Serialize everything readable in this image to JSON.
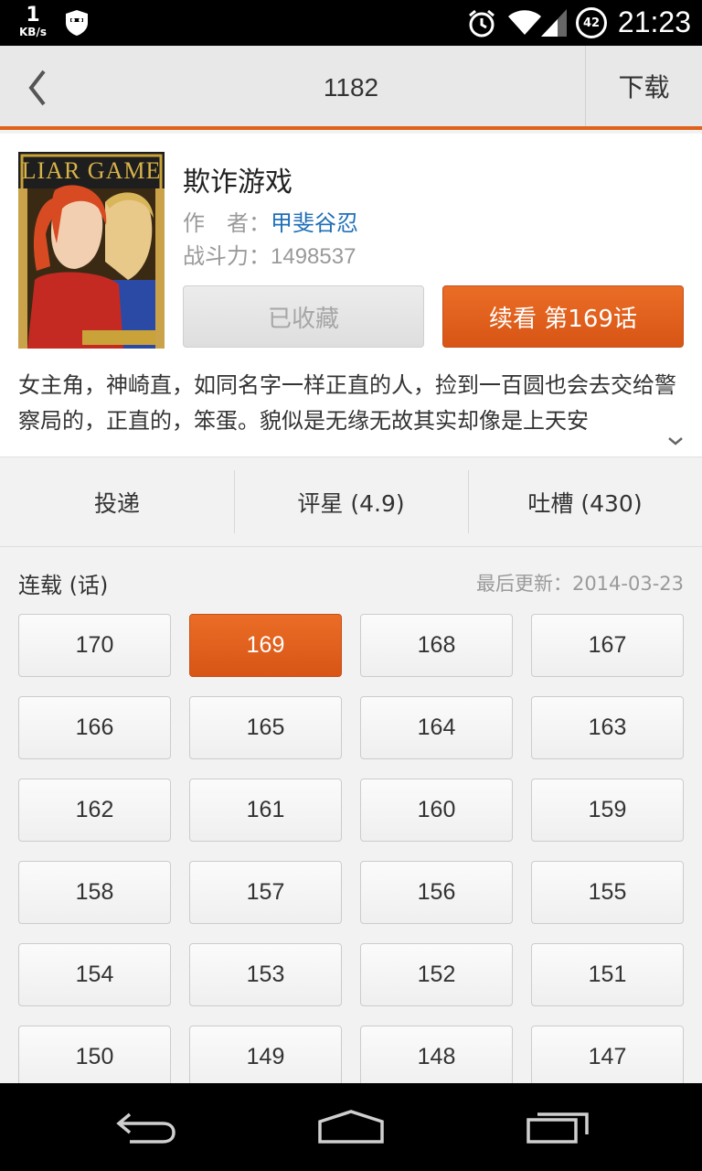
{
  "status_bar": {
    "net_speed_value": "1",
    "net_speed_unit": "KB/s",
    "battery_level": "42",
    "time": "21:23"
  },
  "action_bar": {
    "title": "1182",
    "download_label": "下载"
  },
  "book": {
    "title": "欺诈游戏",
    "cover_lettering": "LIAR GAME",
    "author_label": "作　者：",
    "author_name": "甲斐谷忍",
    "power_label": "战斗力：",
    "power_value": "1498537",
    "collected_label": "已收藏",
    "continue_label": "续看 第169话",
    "description": "女主角，神崎直，如同名字一样正直的人，捡到一百圆也会去交给警察局的，正直的，笨蛋。貌似是无缘无故其实却像是上天安"
  },
  "tabs": [
    {
      "label": "投递"
    },
    {
      "label": "评星 (4.9)"
    },
    {
      "label": "吐槽 (430)"
    }
  ],
  "chapters": {
    "title": "连载 (话)",
    "last_update": "最后更新：2014-03-23",
    "active": "169",
    "items": [
      "170",
      "169",
      "168",
      "167",
      "166",
      "165",
      "164",
      "163",
      "162",
      "161",
      "160",
      "159",
      "158",
      "157",
      "156",
      "155",
      "154",
      "153",
      "152",
      "151",
      "150",
      "149",
      "148",
      "147"
    ]
  },
  "colors": {
    "accent": "#e0621a",
    "link": "#1f6fb8"
  }
}
